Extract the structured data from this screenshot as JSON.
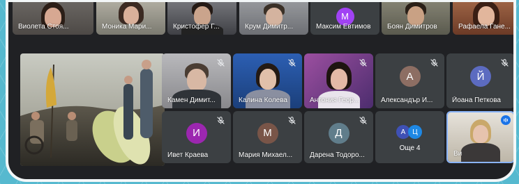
{
  "participants_top": [
    {
      "name": "Виолета Стоя...",
      "tone": "#6b5a52"
    },
    {
      "name": "Моника Мари...",
      "tone": "#8e8a7d"
    },
    {
      "name": "Кристофер Г...",
      "tone": "#5e5f66"
    },
    {
      "name": "Крум Димитр...",
      "tone": "#74757a"
    },
    {
      "name": "Максим Евтимов",
      "initial": "М",
      "color": "#a142f4"
    },
    {
      "name": "Боян Димитров",
      "tone": "#6b6455"
    },
    {
      "name": "Рафаела Гане...",
      "tone": "#7a4a36"
    }
  ],
  "participants_mid": [
    {
      "name": "Камен Димит...",
      "tone": "#9a9a9f"
    },
    {
      "name": "Калина Колева",
      "tone": "#2e5ea8"
    },
    {
      "name": "Антония Геор...",
      "tone": "#8a4c8f"
    },
    {
      "name": "Александър И...",
      "initial": "А",
      "color": "#8d6e63"
    },
    {
      "name": "Йоана Петкова",
      "initial": "Й",
      "color": "#5c6bc0"
    }
  ],
  "participants_bot": [
    {
      "name": "Ивет Краева",
      "initial": "И",
      "color": "#9c27b0"
    },
    {
      "name": "Мария Михаел...",
      "initial": "М",
      "color": "#795548"
    },
    {
      "name": "Дарена Тодоро...",
      "initial": "Д",
      "color": "#607d8b"
    }
  ],
  "others": {
    "label": "Още 4",
    "initials": [
      "А",
      "Ц"
    ],
    "colors": [
      "#3f51b5",
      "#1e88e5"
    ]
  },
  "self_tile": {
    "name": "Ви",
    "tone": "#d7d2c8"
  },
  "colors": {
    "tile_bg": "#3c4043",
    "frame_bg": "#202124",
    "active_border": "#8ab4f8"
  }
}
